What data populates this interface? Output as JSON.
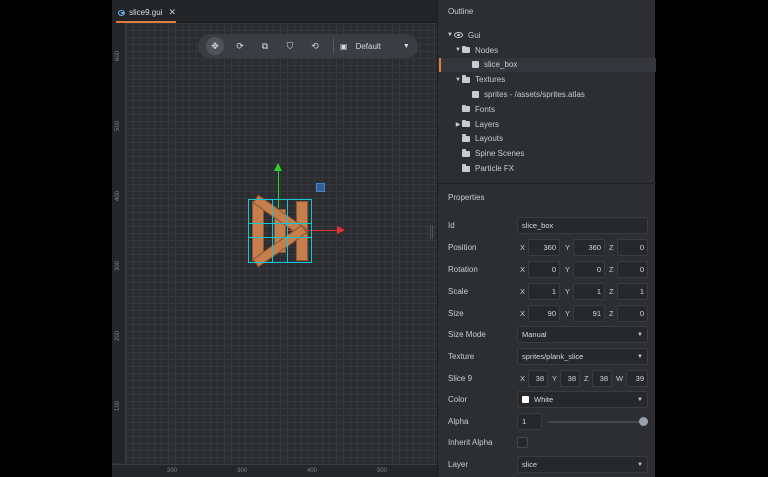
{
  "tab": {
    "title": "slice9.gui",
    "close_glyph": "✕"
  },
  "toolbar": {
    "tools": [
      {
        "name": "move-tool-icon",
        "glyph": "✥"
      },
      {
        "name": "rotate-tool-icon",
        "glyph": "⟳"
      },
      {
        "name": "scale-tool-icon",
        "glyph": "⧉"
      },
      {
        "name": "visibility-filter-icon",
        "glyph": "⛉"
      },
      {
        "name": "camera-reset-icon",
        "glyph": "⟲"
      }
    ],
    "layout_icon": "▣",
    "layout_value": "Default",
    "caret": "▼"
  },
  "rulers": {
    "vertical": [
      "600",
      "500",
      "400",
      "300",
      "200",
      "100"
    ],
    "horizontal": [
      "200",
      "300",
      "400",
      "500"
    ]
  },
  "outline": {
    "title": "Outline",
    "items": [
      {
        "label": "Gui",
        "arrow": "▼",
        "icon": "eye"
      },
      {
        "label": "Nodes",
        "arrow": "▼",
        "icon": "folder"
      },
      {
        "label": "slice_box",
        "arrow": "",
        "icon": "node",
        "selected": true
      },
      {
        "label": "Textures",
        "arrow": "▼",
        "icon": "folder"
      },
      {
        "label": "sprites - /assets/sprites.atlas",
        "arrow": "",
        "icon": "node"
      },
      {
        "label": "Fonts",
        "arrow": "",
        "icon": "folder"
      },
      {
        "label": "Layers",
        "arrow": "▶",
        "icon": "folder"
      },
      {
        "label": "Layouts",
        "arrow": "",
        "icon": "folder"
      },
      {
        "label": "Spine Scenes",
        "arrow": "",
        "icon": "folder"
      },
      {
        "label": "Particle FX",
        "arrow": "",
        "icon": "folder"
      }
    ]
  },
  "properties": {
    "title": "Properties",
    "id": {
      "label": "Id",
      "value": "slice_box"
    },
    "position": {
      "label": "Position",
      "x": "360",
      "y": "360",
      "z": "0"
    },
    "rotation": {
      "label": "Rotation",
      "x": "0",
      "y": "0",
      "z": "0"
    },
    "scale": {
      "label": "Scale",
      "x": "1",
      "y": "1",
      "z": "1"
    },
    "size": {
      "label": "Size",
      "x": "90",
      "y": "91",
      "z": "0"
    },
    "size_mode": {
      "label": "Size Mode",
      "value": "Manual"
    },
    "texture": {
      "label": "Texture",
      "value": "sprites/plank_slice"
    },
    "slice9": {
      "label": "Slice 9",
      "x": "38",
      "y": "38",
      "z": "38",
      "w": "39"
    },
    "color": {
      "label": "Color",
      "value": "White"
    },
    "alpha": {
      "label": "Alpha",
      "value": "1"
    },
    "inherit_alpha": {
      "label": "Inherit Alpha"
    },
    "layer": {
      "label": "Layer",
      "value": "slice"
    },
    "axes": {
      "x": "X",
      "y": "Y",
      "z": "Z",
      "w": "W"
    },
    "caret": "▼"
  },
  "colors": {
    "accent": "#e07c3c",
    "gizmo_x": "#e23131",
    "gizmo_y": "#2fd22f",
    "slice_lines": "#16c7d3"
  }
}
